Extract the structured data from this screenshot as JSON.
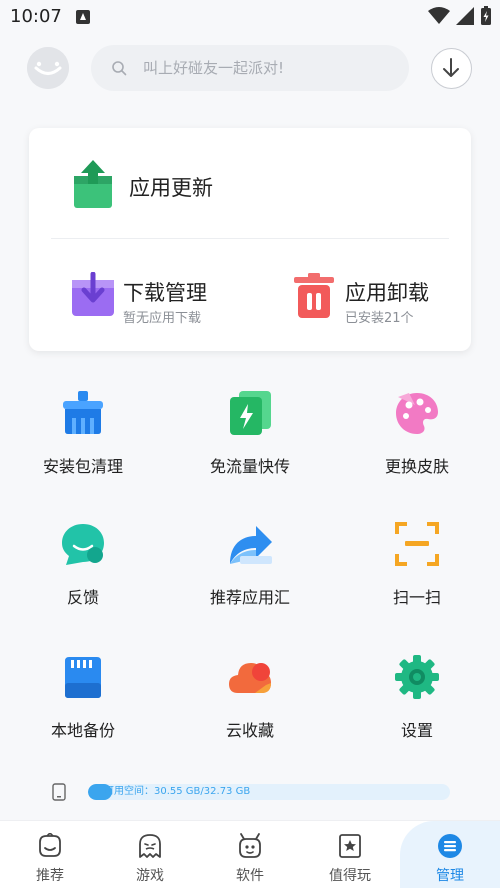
{
  "status_bar": {
    "time": "10:07"
  },
  "header": {
    "search_placeholder": "叫上好碰友一起派对!"
  },
  "card": {
    "update": {
      "title": "应用更新"
    },
    "download": {
      "title": "下载管理",
      "subtitle": "暂无应用下载"
    },
    "uninstall": {
      "title": "应用卸载",
      "subtitle": "已安装21个"
    }
  },
  "grid": [
    {
      "label": "安装包清理",
      "icon": "brush-icon"
    },
    {
      "label": "免流量快传",
      "icon": "bolt-transfer-icon"
    },
    {
      "label": "更换皮肤",
      "icon": "palette-icon"
    },
    {
      "label": "反馈",
      "icon": "feedback-bubble-icon"
    },
    {
      "label": "推荐应用汇",
      "icon": "share-arrow-icon"
    },
    {
      "label": "扫一扫",
      "icon": "scan-icon"
    },
    {
      "label": "本地备份",
      "icon": "sd-card-icon"
    },
    {
      "label": "云收藏",
      "icon": "cloud-icon"
    },
    {
      "label": "设置",
      "icon": "gear-icon"
    }
  ],
  "storage": {
    "text": "可用空间：30.55 GB/32.73 GB",
    "used_fraction": 0.067
  },
  "bottom_nav": [
    {
      "label": "推荐",
      "icon": "recommend-face-icon"
    },
    {
      "label": "游戏",
      "icon": "game-ghost-icon"
    },
    {
      "label": "软件",
      "icon": "software-robot-icon"
    },
    {
      "label": "值得玩",
      "icon": "bookmark-star-icon"
    },
    {
      "label": "管理",
      "icon": "manage-icon",
      "active": true
    }
  ],
  "colors": {
    "accent": "#1e88e5",
    "storage_fill": "#3ba5ee",
    "update_green": "#2db56b",
    "download_purple": "#8a5ae8",
    "uninstall_red": "#f25a5a"
  }
}
